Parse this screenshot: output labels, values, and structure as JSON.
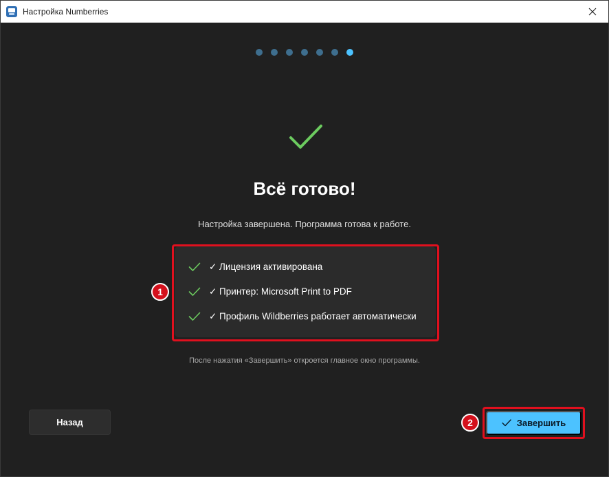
{
  "window": {
    "title": "Настройка Numberries",
    "icon": "numberries-app-icon",
    "close_icon": "close-icon"
  },
  "progress": {
    "total_steps": 7,
    "current_step": 7
  },
  "main": {
    "heading": "Всё готово!",
    "subtitle": "Настройка завершена. Программа готова к работе.",
    "summary": [
      {
        "text": "✓ Лицензия активирована"
      },
      {
        "text": "✓ Принтер: Microsoft Print to PDF"
      },
      {
        "text": "✓ Профиль Wildberries работает автоматически"
      }
    ],
    "note": "После нажатия «Завершить» откроется главное окно программы."
  },
  "buttons": {
    "back_label": "Назад",
    "finish_label": "Завершить"
  },
  "annotations": {
    "marker_1": "1",
    "marker_2": "2"
  },
  "colors": {
    "accent": "#4cc2ff",
    "success": "#6ccb5f",
    "annotation": "#e0101e",
    "background": "#202020",
    "card": "#2b2b2b"
  }
}
